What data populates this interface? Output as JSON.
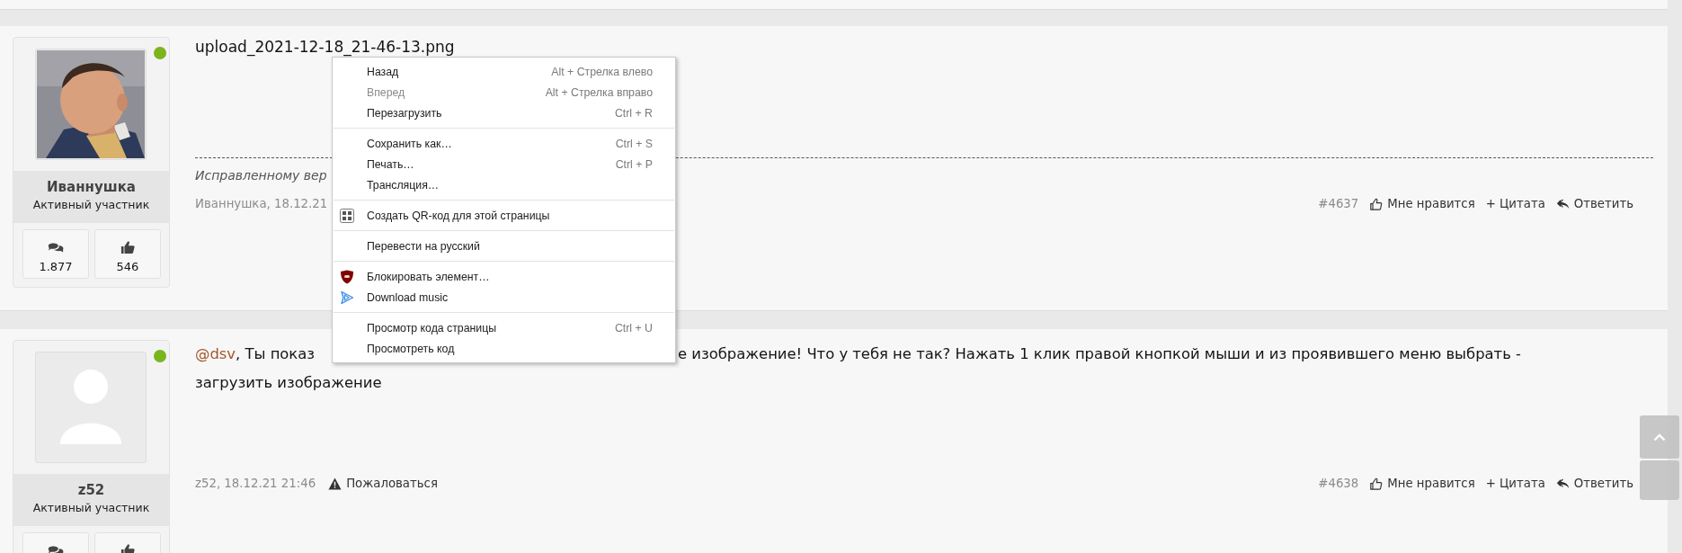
{
  "posts": [
    {
      "author": "Иваннушка",
      "role": "Активный участник",
      "online": true,
      "stats": [
        {
          "kind": "messages",
          "value": "1.877"
        },
        {
          "kind": "likes",
          "value": "546"
        }
      ],
      "title": "upload_2021-12-18_21-46-13.png",
      "signature": "Исправленному вер",
      "meta": "Иваннушка, 18.12.21",
      "number": "#4637",
      "actions": [
        {
          "kind": "like",
          "label": "Мне нравится"
        },
        {
          "kind": "quote",
          "label": "+ Цитата"
        },
        {
          "kind": "reply",
          "label": "Ответить"
        }
      ]
    },
    {
      "author": "z52",
      "role": "Активный участник",
      "online": true,
      "kind": "placeholder",
      "stats": [
        {
          "kind": "messages"
        },
        {
          "kind": "likes"
        }
      ],
      "body": [
        [
          {
            "kind": "mention",
            "text": "@dsv"
          },
          {
            "kind": "text",
            "text": ", Ты показ"
          },
          {
            "kind": "hidden"
          },
          {
            "kind": "text",
            "text": "е изображение! Что у тебя не так? Нажать 1 клик правой кнопкой мыши и из проявившего меню выбрать -"
          }
        ],
        [
          {
            "kind": "text",
            "text": "загрузить изображение"
          }
        ]
      ],
      "meta": "z52, 18.12.21 21:46",
      "report": "Пожаловаться",
      "number": "#4638",
      "actions": [
        {
          "kind": "like",
          "label": "Мне нравится"
        },
        {
          "kind": "quote",
          "label": "+ Цитата"
        },
        {
          "kind": "reply",
          "label": "Ответить"
        }
      ]
    }
  ],
  "context_menu": [
    {
      "kind": "item",
      "label": "Назад",
      "shortcut": "Alt + Стрелка влево",
      "disabled": false
    },
    {
      "kind": "item",
      "label": "Вперед",
      "shortcut": "Alt + Стрелка вправо",
      "disabled": true
    },
    {
      "kind": "item",
      "label": "Перезагрузить",
      "shortcut": "Ctrl + R",
      "disabled": false
    },
    {
      "kind": "separator"
    },
    {
      "kind": "item",
      "label": "Сохранить как…",
      "shortcut": "Ctrl + S",
      "disabled": false
    },
    {
      "kind": "item",
      "label": "Печать…",
      "shortcut": "Ctrl + P",
      "disabled": false
    },
    {
      "kind": "item",
      "label": "Трансляция…",
      "disabled": false
    },
    {
      "kind": "separator"
    },
    {
      "kind": "qr",
      "label": "Создать QR-код для этой страницы",
      "disabled": false
    },
    {
      "kind": "separator"
    },
    {
      "kind": "item",
      "label": "Перевести на русский",
      "disabled": false
    },
    {
      "kind": "separator"
    },
    {
      "kind": "shield",
      "label": "Блокировать элемент…",
      "disabled": false
    },
    {
      "kind": "play",
      "label": "Download music",
      "disabled": false
    },
    {
      "kind": "separator"
    },
    {
      "kind": "item",
      "label": "Просмотр кода страницы",
      "shortcut": "Ctrl + U",
      "disabled": false
    },
    {
      "kind": "item",
      "label": "Просмотреть код",
      "disabled": false
    }
  ]
}
